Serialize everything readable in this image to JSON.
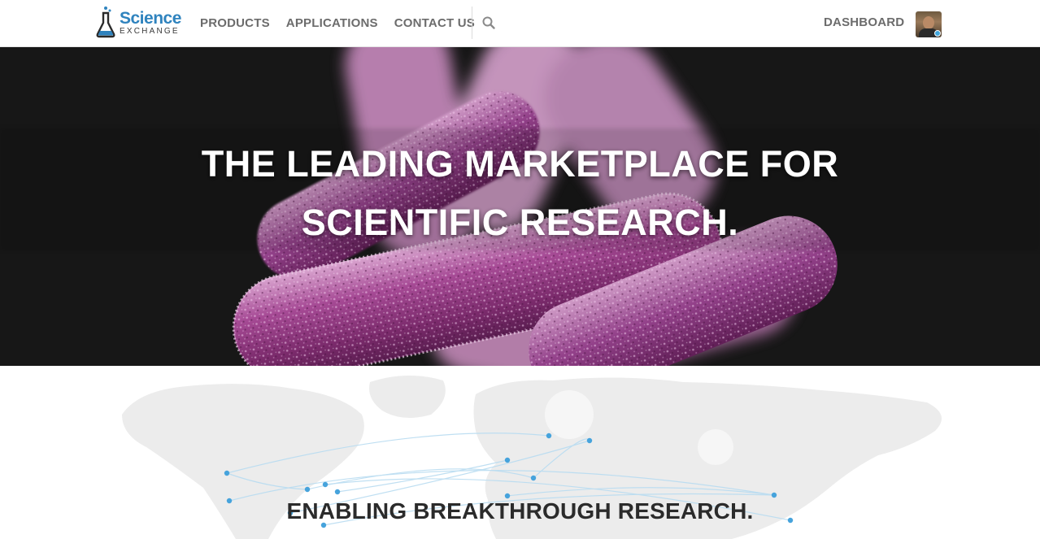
{
  "brand": {
    "name": "Science",
    "subtitle": "EXCHANGE",
    "accent_color": "#2f83be"
  },
  "nav": {
    "items": [
      {
        "label": "PRODUCTS"
      },
      {
        "label": "APPLICATIONS"
      },
      {
        "label": "CONTACT US"
      }
    ],
    "search_icon": "search-icon",
    "dashboard_label": "DASHBOARD",
    "avatar_icon": "user-avatar"
  },
  "hero": {
    "line1": "THE LEADING MARKETPLACE FOR",
    "line2": "SCIENTIFIC RESEARCH."
  },
  "map": {
    "tagline": "ENABLING BREAKTHROUGH RESEARCH.",
    "dot_color": "#46a3dc"
  }
}
